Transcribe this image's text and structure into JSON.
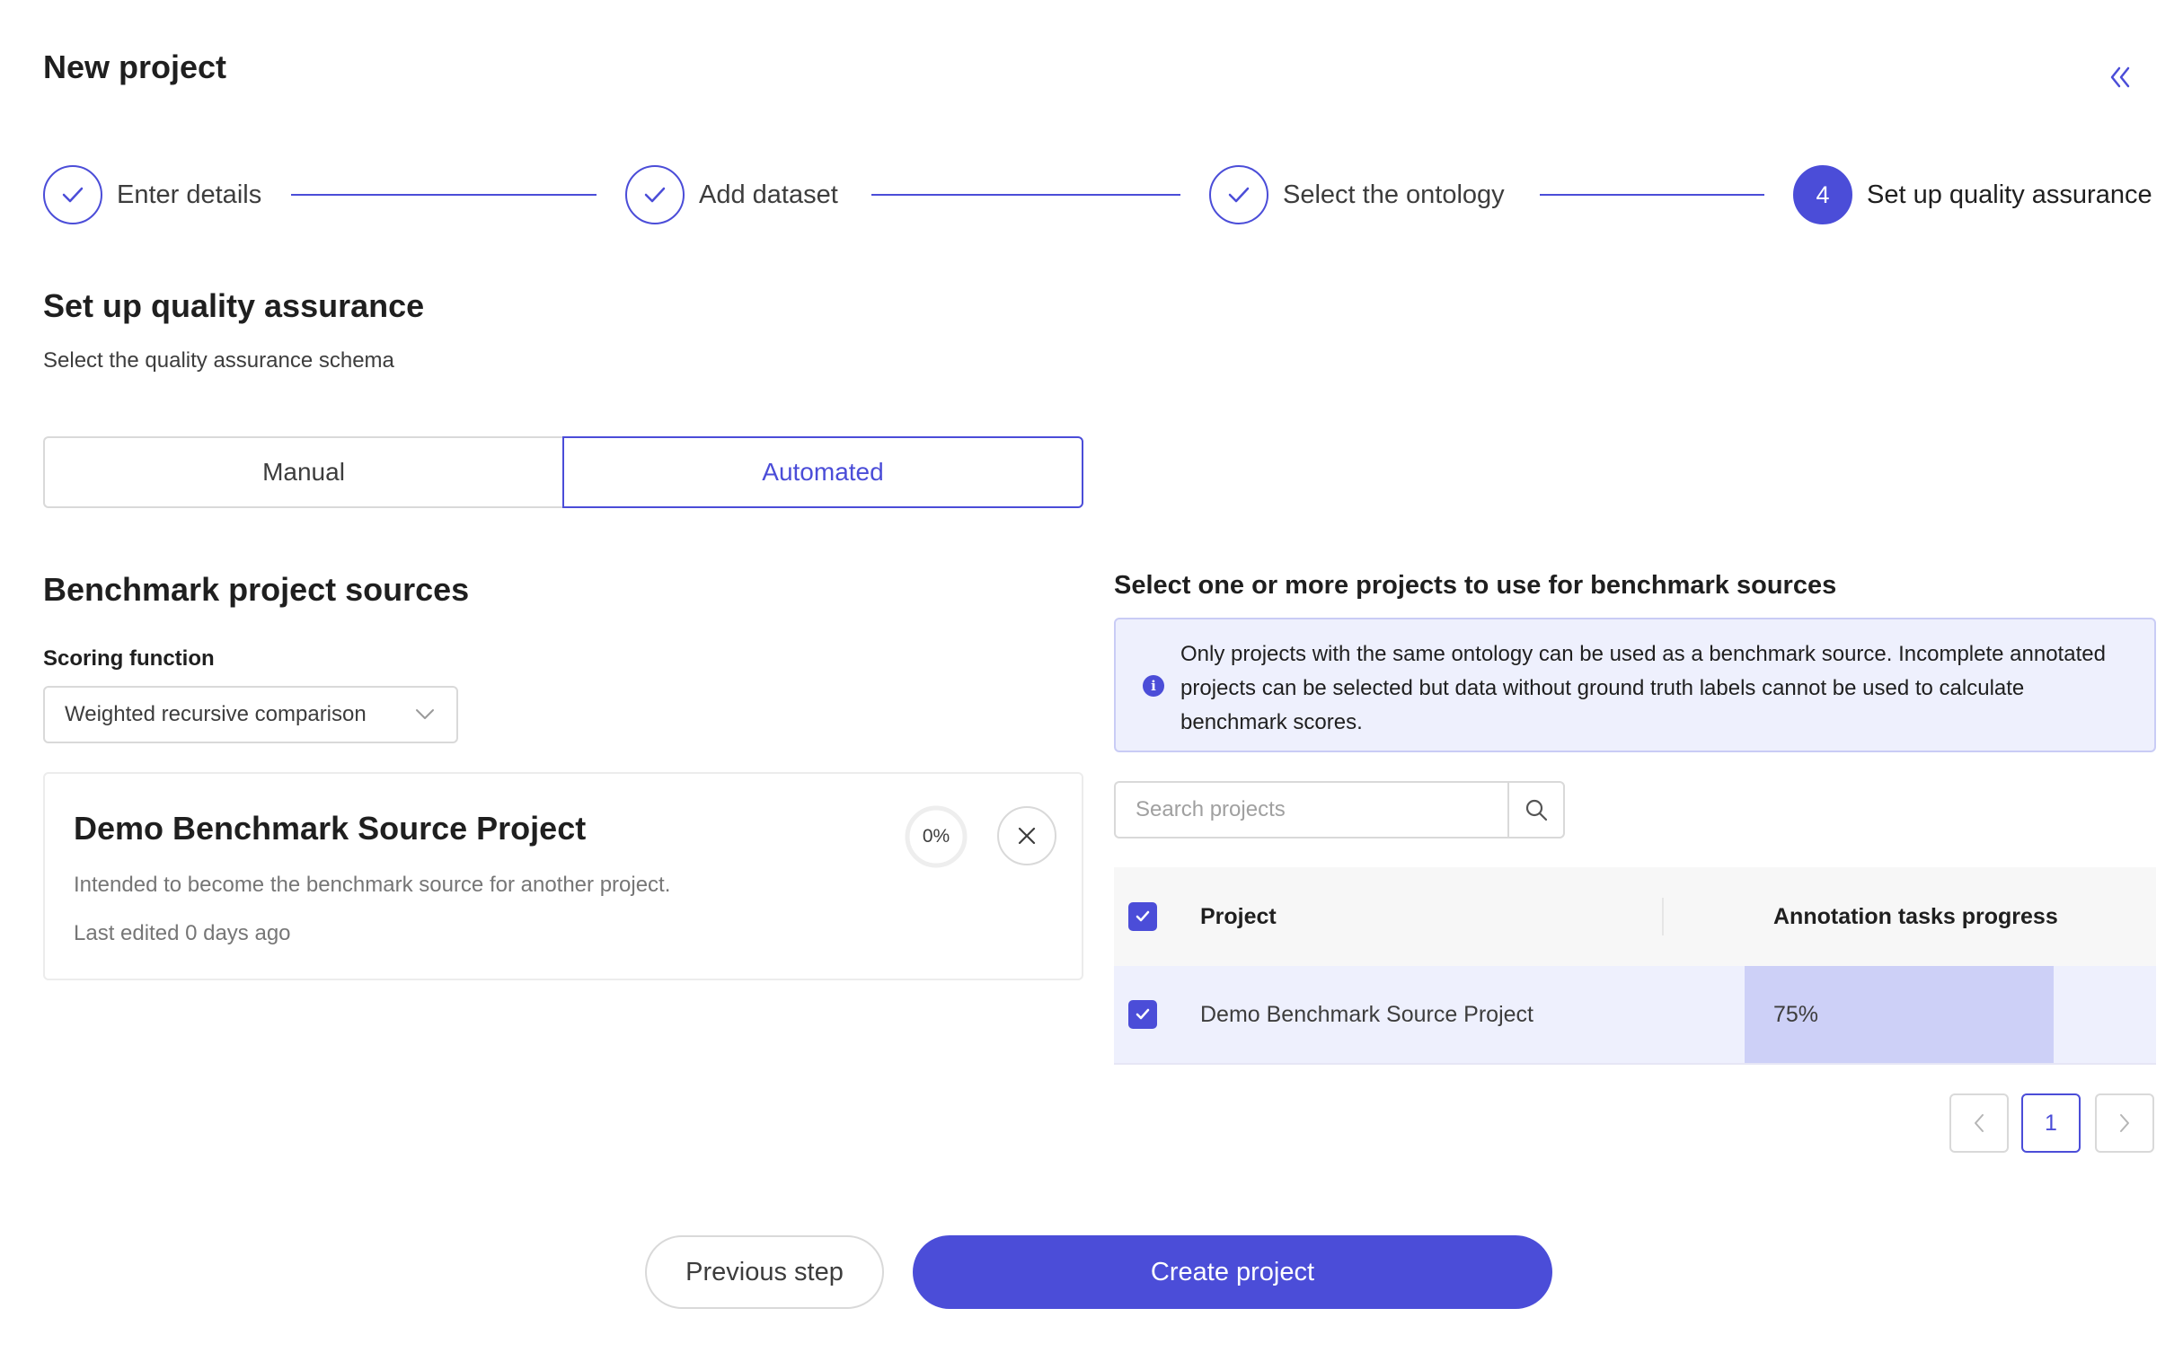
{
  "header": {
    "title": "New project",
    "collapse_icon": "double-chevron-left-icon"
  },
  "stepper": {
    "steps": [
      {
        "label": "Enter details",
        "status": "complete"
      },
      {
        "label": "Add dataset",
        "status": "complete"
      },
      {
        "label": "Select the ontology",
        "status": "complete"
      },
      {
        "label": "Set up quality assurance",
        "status": "current",
        "number": "4"
      }
    ]
  },
  "qa": {
    "title": "Set up quality assurance",
    "subtitle": "Select the quality assurance schema",
    "modes": {
      "manual": "Manual",
      "automated": "Automated"
    },
    "selected_mode": "Automated"
  },
  "benchmark": {
    "title": "Benchmark project sources",
    "scoring_label": "Scoring function",
    "scoring_value": "Weighted recursive comparison",
    "card": {
      "title": "Demo Benchmark Source Project",
      "description": "Intended to become the benchmark source for another project.",
      "meta": "Last edited 0 days ago",
      "progress_label": "0%",
      "progress": 0
    }
  },
  "sources": {
    "title": "Select one or more projects to use for benchmark sources",
    "info": "Only projects with the same ontology can be used as a benchmark source. Incomplete annotated projects can be selected but data without ground truth labels cannot be used to calculate benchmark scores.",
    "search_placeholder": "Search projects",
    "columns": {
      "project": "Project",
      "progress": "Annotation tasks progress"
    },
    "rows": [
      {
        "project": "Demo Benchmark Source Project",
        "progress_label": "75%",
        "progress": 0.75,
        "checked": true
      }
    ],
    "pagination": {
      "current_page": "1"
    }
  },
  "footer": {
    "previous_label": "Previous step",
    "create_label": "Create project"
  },
  "colors": {
    "accent": "#4b4dd8",
    "info_bg": "#eef0fd",
    "progress_fill": "#cdd0f7"
  }
}
